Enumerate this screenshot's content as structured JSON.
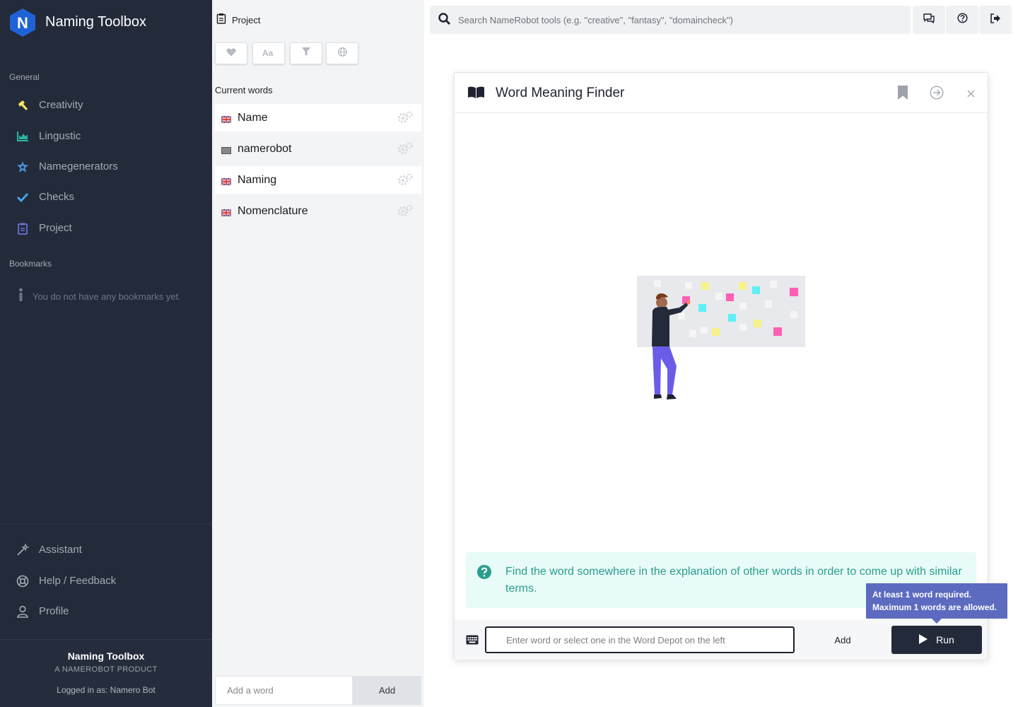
{
  "sidebar": {
    "app_title": "Naming Toolbox",
    "logo_letter": "N",
    "general_label": "General",
    "nav": [
      {
        "label": "Creativity",
        "icon": "hammer-icon",
        "color": "#f5e663"
      },
      {
        "label": "Lingustic",
        "icon": "chart-area-icon",
        "color": "#2bb5a3"
      },
      {
        "label": "Namegenerators",
        "icon": "star-badge-icon",
        "color": "#4a90d9"
      },
      {
        "label": "Checks",
        "icon": "check-icon",
        "color": "#4aa3e8"
      },
      {
        "label": "Project",
        "icon": "clipboard-icon",
        "color": "#6c72d6"
      }
    ],
    "bookmarks_label": "Bookmarks",
    "no_bookmarks": "You do not have any bookmarks yet.",
    "bottom_nav": [
      {
        "label": "Assistant",
        "icon": "magic-wand-icon"
      },
      {
        "label": "Help / Feedback",
        "icon": "lifebuoy-icon"
      },
      {
        "label": "Profile",
        "icon": "user-icon"
      }
    ],
    "footer": {
      "title": "Naming Toolbox",
      "subtitle": "A NAMEROBOT PRODUCT",
      "logged_in": "Logged in as: Namero Bot"
    }
  },
  "project_panel": {
    "title": "Project",
    "filter_buttons": [
      "heart-icon",
      "font-case-icon",
      "filter-icon",
      "globe-icon"
    ],
    "current_words_label": "Current words",
    "words": [
      {
        "label": "Name",
        "flag": "uk-flag-icon",
        "highlighted": true
      },
      {
        "label": "namerobot",
        "flag": "neutral-flag-icon",
        "highlighted": false
      },
      {
        "label": "Naming",
        "flag": "uk-flag-icon",
        "highlighted": true
      },
      {
        "label": "Nomenclature",
        "flag": "uk-flag-icon",
        "highlighted": false
      }
    ],
    "add_placeholder": "Add a word",
    "add_button": "Add"
  },
  "topbar": {
    "search_placeholder": "Search NameRobot tools (e.g. \"creative\", \"fantasy\", \"domaincheck\")",
    "buttons": [
      "chat-icon",
      "help-circle-icon",
      "logout-icon"
    ]
  },
  "tool": {
    "title": "Word Meaning Finder",
    "info_text": "Find the word somewhere in the explanation of other words in order to come up with similar terms.",
    "input_placeholder": "Enter word or select one in the Word Depot on the left",
    "add_label": "Add",
    "run_label": "Run",
    "tooltip_line1": "At least 1 word required.",
    "tooltip_line2": "Maximum 1 words are allowed."
  },
  "colors": {
    "sidebar_bg": "#232a3a",
    "logo_blue": "#1e63d6",
    "info_teal": "#2a9d8f",
    "tooltip_bg": "#5c6bc0"
  }
}
